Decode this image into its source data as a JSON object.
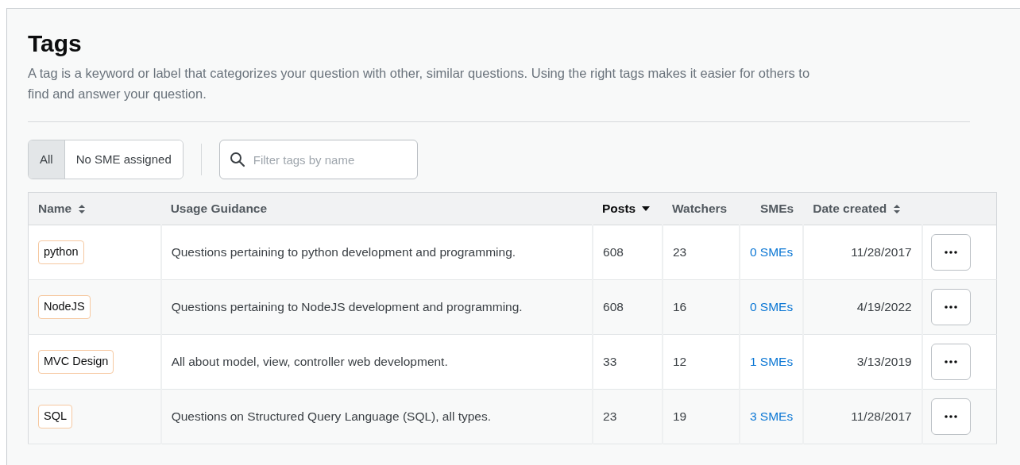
{
  "header": {
    "title": "Tags",
    "description": "A tag is a keyword or label that categorizes your question with other, similar questions. Using the right tags makes it easier for others to find and answer your question."
  },
  "filters": [
    {
      "label": "All",
      "selected": true
    },
    {
      "label": "No SME assigned",
      "selected": false
    }
  ],
  "search": {
    "placeholder": "Filter tags by name"
  },
  "table": {
    "columns": [
      {
        "label": "Name",
        "sortable": true,
        "sorted": false
      },
      {
        "label": "Usage Guidance",
        "sortable": false,
        "sorted": false
      },
      {
        "label": "Posts",
        "sortable": true,
        "sorted": true
      },
      {
        "label": "Watchers",
        "sortable": false,
        "sorted": false
      },
      {
        "label": "SMEs",
        "sortable": false,
        "sorted": false
      },
      {
        "label": "Date created",
        "sortable": true,
        "sorted": false
      }
    ],
    "rows": [
      {
        "tag": "python",
        "guidance": "Questions pertaining to python development and programming.",
        "posts": "608",
        "watchers": "23",
        "smes": "0 SMEs",
        "date": "11/28/2017"
      },
      {
        "tag": "NodeJS",
        "guidance": "Questions pertaining to NodeJS development and programming.",
        "posts": "608",
        "watchers": "16",
        "smes": "0 SMEs",
        "date": "4/19/2022"
      },
      {
        "tag": "MVC Design",
        "guidance": "All about model, view, controller web development.",
        "posts": "33",
        "watchers": "12",
        "smes": "1 SMEs",
        "date": "3/13/2019"
      },
      {
        "tag": "SQL",
        "guidance": "Questions on Structured Query Language (SQL), all types.",
        "posts": "23",
        "watchers": "19",
        "smes": "3 SMEs",
        "date": "11/28/2017"
      }
    ]
  }
}
